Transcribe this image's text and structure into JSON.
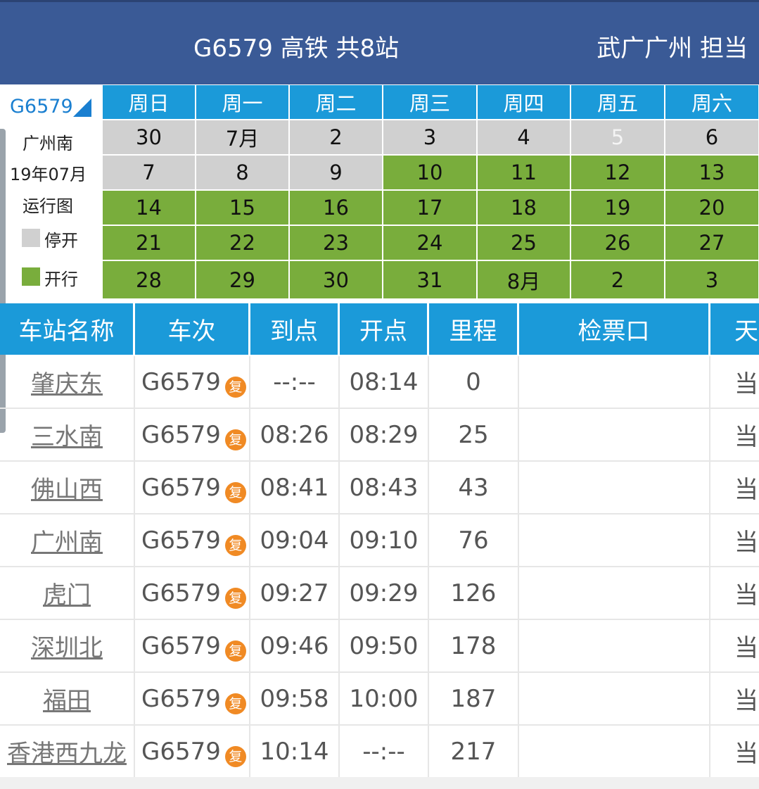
{
  "header": {
    "title": "G6579 高铁 共8站",
    "owner": "武广广州 担当"
  },
  "calendar_side": {
    "train": "G6579",
    "station": "广州南",
    "month": "19年07月",
    "chart_label": "运行图",
    "legend_stop": "停开",
    "legend_run": "开行",
    "colors": {
      "stop": "#d0d0d0",
      "run": "#79ad3c",
      "header": "#1b9ad9"
    }
  },
  "calendar": {
    "weekdays": [
      "周日",
      "周一",
      "周二",
      "周三",
      "周四",
      "周五",
      "周六"
    ],
    "rows": [
      [
        {
          "d": "30",
          "s": "stop"
        },
        {
          "d": "7月",
          "s": "stop"
        },
        {
          "d": "2",
          "s": "stop"
        },
        {
          "d": "3",
          "s": "stop"
        },
        {
          "d": "4",
          "s": "stop"
        },
        {
          "d": "5",
          "s": "stop",
          "today": true
        },
        {
          "d": "6",
          "s": "stop"
        }
      ],
      [
        {
          "d": "7",
          "s": "stop"
        },
        {
          "d": "8",
          "s": "stop"
        },
        {
          "d": "9",
          "s": "stop"
        },
        {
          "d": "10",
          "s": "run"
        },
        {
          "d": "11",
          "s": "run"
        },
        {
          "d": "12",
          "s": "run"
        },
        {
          "d": "13",
          "s": "run"
        }
      ],
      [
        {
          "d": "14",
          "s": "run"
        },
        {
          "d": "15",
          "s": "run"
        },
        {
          "d": "16",
          "s": "run"
        },
        {
          "d": "17",
          "s": "run"
        },
        {
          "d": "18",
          "s": "run"
        },
        {
          "d": "19",
          "s": "run"
        },
        {
          "d": "20",
          "s": "run"
        }
      ],
      [
        {
          "d": "21",
          "s": "run"
        },
        {
          "d": "22",
          "s": "run"
        },
        {
          "d": "23",
          "s": "run"
        },
        {
          "d": "24",
          "s": "run"
        },
        {
          "d": "25",
          "s": "run"
        },
        {
          "d": "26",
          "s": "run"
        },
        {
          "d": "27",
          "s": "run"
        }
      ],
      [
        {
          "d": "28",
          "s": "run"
        },
        {
          "d": "29",
          "s": "run"
        },
        {
          "d": "30",
          "s": "run"
        },
        {
          "d": "31",
          "s": "run"
        },
        {
          "d": "8月",
          "s": "run"
        },
        {
          "d": "2",
          "s": "run"
        },
        {
          "d": "3",
          "s": "run"
        }
      ]
    ]
  },
  "table": {
    "headers": [
      "车站名称",
      "车次",
      "到点",
      "开点",
      "里程",
      "检票口",
      "天"
    ],
    "badge": "复",
    "rows": [
      {
        "station": "肇庆东",
        "train": "G6579",
        "arrive": "--:--",
        "depart": "08:14",
        "km": "0",
        "gate": "",
        "day": "当"
      },
      {
        "station": "三水南",
        "train": "G6579",
        "arrive": "08:26",
        "depart": "08:29",
        "km": "25",
        "gate": "",
        "day": "当"
      },
      {
        "station": "佛山西",
        "train": "G6579",
        "arrive": "08:41",
        "depart": "08:43",
        "km": "43",
        "gate": "",
        "day": "当"
      },
      {
        "station": "广州南",
        "train": "G6579",
        "arrive": "09:04",
        "depart": "09:10",
        "km": "76",
        "gate": "",
        "day": "当"
      },
      {
        "station": "虎门",
        "train": "G6579",
        "arrive": "09:27",
        "depart": "09:29",
        "km": "126",
        "gate": "",
        "day": "当"
      },
      {
        "station": "深圳北",
        "train": "G6579",
        "arrive": "09:46",
        "depart": "09:50",
        "km": "178",
        "gate": "",
        "day": "当"
      },
      {
        "station": "福田",
        "train": "G6579",
        "arrive": "09:58",
        "depart": "10:00",
        "km": "187",
        "gate": "",
        "day": "当"
      },
      {
        "station": "香港西九龙",
        "train": "G6579",
        "arrive": "10:14",
        "depart": "--:--",
        "km": "217",
        "gate": "",
        "day": "当"
      }
    ]
  }
}
